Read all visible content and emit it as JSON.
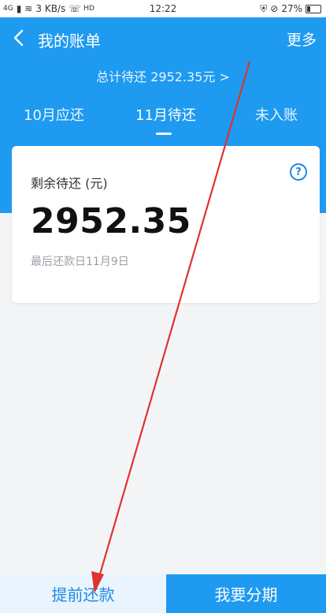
{
  "status_bar": {
    "signal": "4G",
    "speed": "3 KB/s",
    "hd": "HD",
    "time": "12:22",
    "battery": "27%"
  },
  "header": {
    "title": "我的账单",
    "more": "更多",
    "total_link": "总计待还 2952.35元 >"
  },
  "tabs": [
    {
      "label": "10月应还"
    },
    {
      "label": "11月待还"
    },
    {
      "label": "未入账"
    }
  ],
  "card": {
    "label": "剩余待还 (元)",
    "amount": "2952.35",
    "note": "最后还款日11月9日",
    "help": "?"
  },
  "bottom": {
    "early_repay": "提前还款",
    "installment": "我要分期"
  },
  "colors": {
    "primary": "#1e9af0",
    "annotation": "#e03131"
  }
}
